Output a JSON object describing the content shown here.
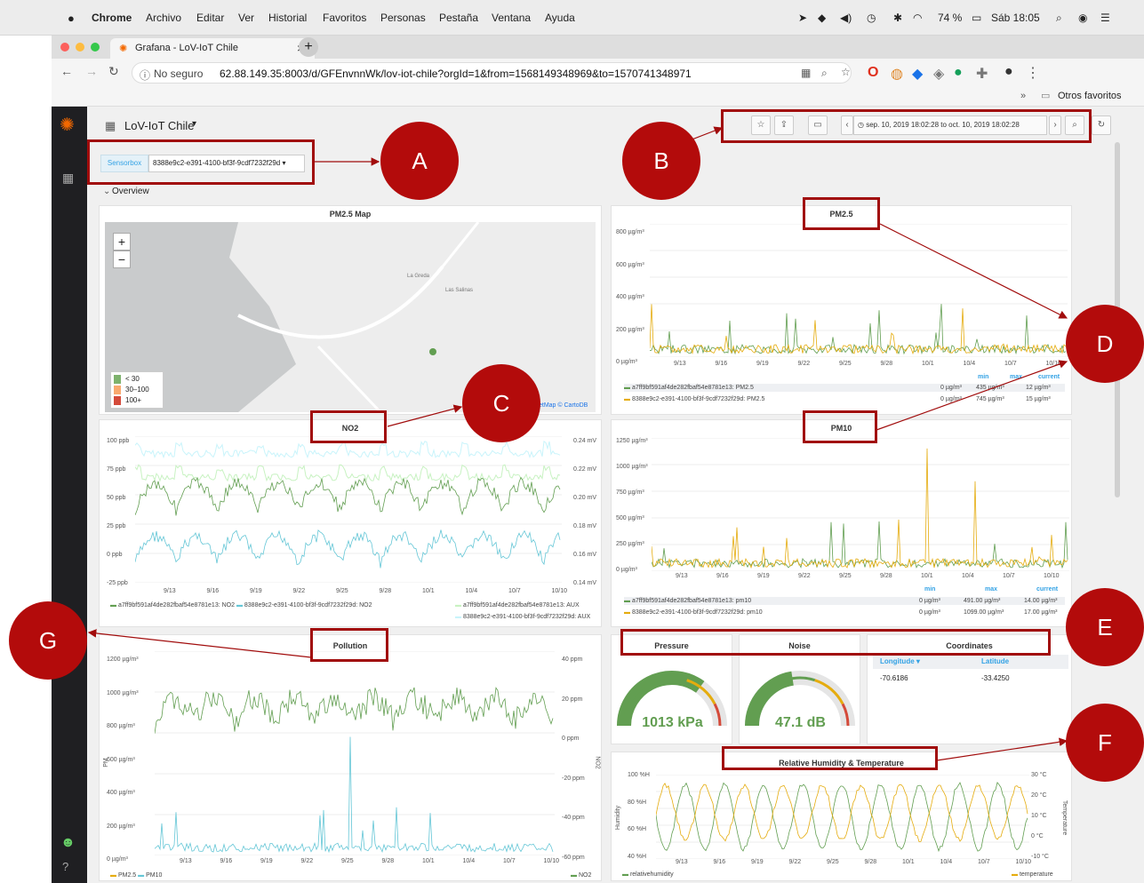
{
  "menubar": {
    "app": "Chrome",
    "items": [
      "Archivo",
      "Editar",
      "Ver",
      "Historial",
      "Favoritos",
      "Personas",
      "Pestaña",
      "Ventana",
      "Ayuda"
    ],
    "battery": "74 %",
    "clock": "Sáb 18:05"
  },
  "tab": {
    "title": "Grafana - LoV-IoT Chile",
    "close": "×",
    "new": "+"
  },
  "address": {
    "security": "No seguro",
    "url": "62.88.149.35:8003/d/GFEnvnnWk/lov-iot-chile?orgId=1&from=1568149348969&to=1570741348971"
  },
  "bookmarks": {
    "chevron": "»",
    "other": "Otros favoritos"
  },
  "dashboard": {
    "title": "LoV-IoT Chile",
    "var_label": "Sensorbox",
    "var_value": "8388e9c2-e391-4100-bf3f-9cdf7232f29d",
    "time_range": "sep. 10, 2019 18:02:28 to oct. 10, 2019 18:02:28",
    "row": "Overview"
  },
  "callouts": [
    "A",
    "B",
    "C",
    "D",
    "E",
    "F",
    "G"
  ],
  "map": {
    "title": "PM2.5 Map",
    "zoom_in": "+",
    "zoom_out": "−",
    "places": [
      "La Greda",
      "Las Salinas"
    ],
    "legend": [
      "< 30",
      "30–100",
      "100+"
    ],
    "attribution": "etMap © CartoDB"
  },
  "xticks": [
    "9/13",
    "9/16",
    "9/19",
    "9/22",
    "9/25",
    "9/28",
    "10/1",
    "10/4",
    "10/7",
    "10/10"
  ],
  "pm25": {
    "title": "PM2.5",
    "yticks": [
      "800 µg/m³",
      "600 µg/m³",
      "400 µg/m³",
      "200 µg/m³",
      "0 µg/m³"
    ],
    "headers": [
      "min",
      "max",
      "current"
    ],
    "rows": [
      {
        "name": "a7ff9bf591af4de282fbaf54e8781e13: PM2.5",
        "min": "0 µg/m³",
        "max": "435 µg/m³",
        "current": "12 µg/m³"
      },
      {
        "name": "8388e9c2-e391-4100-bf3f-9cdf7232f29d: PM2.5",
        "min": "0 µg/m³",
        "max": "745 µg/m³",
        "current": "15 µg/m³"
      }
    ]
  },
  "no2": {
    "title": "NO2",
    "yticks": [
      "100 ppb",
      "75 ppb",
      "50 ppb",
      "25 ppb",
      "0 ppb",
      "-25 ppb"
    ],
    "y2ticks": [
      "0.24 mV",
      "0.22 mV",
      "0.20 mV",
      "0.18 mV",
      "0.16 mV",
      "0.14 mV"
    ],
    "legend": [
      "a7ff9bf591af4de282fbaf54e8781e13: NO2",
      "8388e9c2-e391-4100-bf3f-9cdf7232f29d: NO2",
      "a7ff9bf591af4de282fbaf54e8781e13: AUX",
      "8388e9c2-e391-4100-bf3f-9cdf7232f29d: AUX"
    ]
  },
  "pm10": {
    "title": "PM10",
    "yticks": [
      "1250 µg/m³",
      "1000 µg/m³",
      "750 µg/m³",
      "500 µg/m³",
      "250 µg/m³",
      "0 µg/m³"
    ],
    "headers": [
      "min",
      "max",
      "current"
    ],
    "rows": [
      {
        "name": "a7ff9bf591af4de282fbaf54e8781e13: pm10",
        "min": "0 µg/m³",
        "max": "491.00 µg/m³",
        "current": "14.00 µg/m³"
      },
      {
        "name": "8388e9c2-e391-4100-bf3f-9cdf7232f29d: pm10",
        "min": "0 µg/m³",
        "max": "1099.00 µg/m³",
        "current": "17.00 µg/m³"
      }
    ]
  },
  "pollution": {
    "title": "Pollution",
    "ylabel": "PM",
    "y2label": "NO2",
    "yticks": [
      "1200 µg/m³",
      "1000 µg/m³",
      "800 µg/m³",
      "600 µg/m³",
      "400 µg/m³",
      "200 µg/m³",
      "0 µg/m³"
    ],
    "y2ticks": [
      "40 ppm",
      "20 ppm",
      "0 ppm",
      "-20 ppm",
      "-40 ppm",
      "-60 ppm"
    ],
    "legend": [
      "PM2.5",
      "PM10"
    ],
    "legend_right": "NO2"
  },
  "pressure": {
    "title": "Pressure",
    "value": "1013 kPa",
    "level": 0.7
  },
  "noise": {
    "title": "Noise",
    "value": "47.1 dB",
    "level": 0.45
  },
  "coordinates": {
    "title": "Coordinates",
    "headers": [
      "Longitude ▾",
      "Latitude"
    ],
    "longitude": "-70.6186",
    "latitude": "-33.4250"
  },
  "humidity": {
    "title": "Relative Humidity & Temperature",
    "ylabel": "Humidity",
    "y2label": "Temperature",
    "yticks": [
      "100 %H",
      "80 %H",
      "60 %H",
      "40 %H"
    ],
    "y2ticks": [
      "30 °C",
      "20 °C",
      "10 °C",
      "0 °C",
      "-10 °C"
    ],
    "legend": "relativehumidity",
    "legend_right": "temperature"
  },
  "colors": {
    "green": "#629e51",
    "yellow": "#e5ac0e",
    "cyan": "#64c6d6",
    "red": "#a10c0c"
  }
}
